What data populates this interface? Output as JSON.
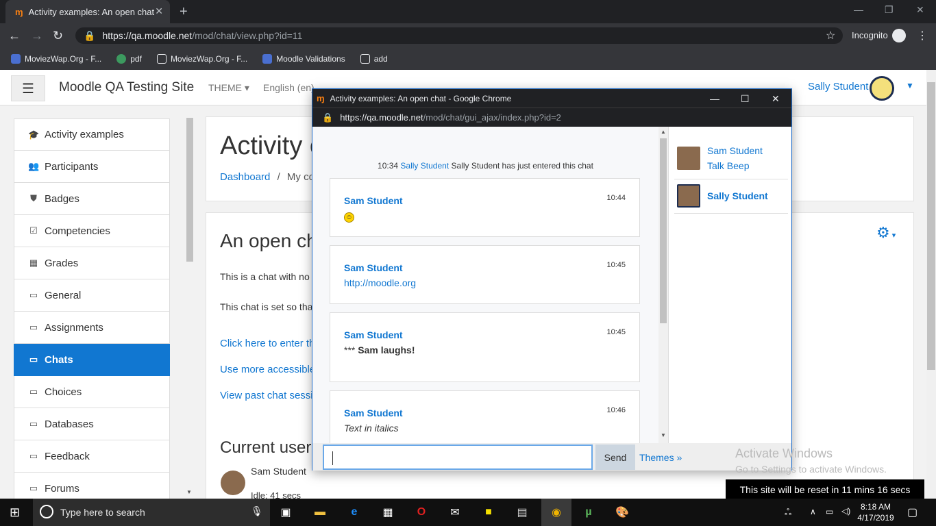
{
  "browser": {
    "tab_title": "Activity examples: An open chat",
    "url_host": "https://qa.moodle.net",
    "url_path": "/mod/chat/view.php?id=11",
    "incognito_label": "Incognito",
    "bookmarks": [
      "MoviezWap.Org - F...",
      "pdf",
      "MoviezWap.Org - F...",
      "Moodle Validations",
      "add"
    ]
  },
  "navbar": {
    "site_name": "Moodle QA Testing Site",
    "theme_menu": "THEME",
    "lang_menu": "English (en)",
    "user_name": "Sally Student"
  },
  "sidebar": {
    "items": [
      {
        "label": "Activity examples",
        "icon": "graduation-cap-icon"
      },
      {
        "label": "Participants",
        "icon": "users-icon"
      },
      {
        "label": "Badges",
        "icon": "shield-icon"
      },
      {
        "label": "Competencies",
        "icon": "checkbox-icon"
      },
      {
        "label": "Grades",
        "icon": "table-icon"
      },
      {
        "label": "General",
        "icon": "folder-icon"
      },
      {
        "label": "Assignments",
        "icon": "folder-icon"
      },
      {
        "label": "Chats",
        "icon": "folder-icon",
        "active": true
      },
      {
        "label": "Choices",
        "icon": "folder-icon"
      },
      {
        "label": "Databases",
        "icon": "folder-icon"
      },
      {
        "label": "Feedback",
        "icon": "folder-icon"
      },
      {
        "label": "Forums",
        "icon": "folder-icon"
      }
    ]
  },
  "main": {
    "heading": "Activity examples",
    "breadcrumb_dashboard": "Dashboard",
    "breadcrumb_sep": "/",
    "breadcrumb_next": "My courses",
    "section_title": "An open chat",
    "intro_1": "This is a chat with no",
    "intro_2": "This chat is set so that",
    "link_enter": "Click here to enter the chat",
    "link_accessible": "Use more accessible interface",
    "link_past": "View past chat sessions",
    "current_users_title": "Current users",
    "current_user_name": "Sam Student",
    "current_user_idle": "Idle: 41 secs"
  },
  "popup": {
    "window_title": "Activity examples: An open chat - Google Chrome",
    "url_host": "https://qa.moodle.net",
    "url_path": "/mod/chat/gui_ajax/index.php?id=2",
    "system_message": {
      "time": "10:34",
      "user": "Sally Student",
      "text": "Sally Student has just entered this chat"
    },
    "messages": [
      {
        "name": "Sam Student",
        "time": "10:44",
        "text": ""
      },
      {
        "name": "Sam Student",
        "time": "10:45",
        "text": "http://moodle.org"
      },
      {
        "name": "Sam Student",
        "time": "10:45",
        "prefix": "***",
        "text": "Sam laughs!"
      },
      {
        "name": "Sam Student",
        "time": "10:46",
        "text": "Text in italics"
      }
    ],
    "users": [
      {
        "name": "Sam Student",
        "action": "Talk",
        "beep": "Beep"
      },
      {
        "name": "Sally Student"
      }
    ],
    "input_value": "",
    "send_label": "Send",
    "themes_label": "Themes »"
  },
  "overlay": {
    "activate_title": "Activate Windows",
    "activate_sub": "Go to Settings to activate Windows.",
    "reset_notice": "This site will be reset in 11 mins 16 secs"
  },
  "taskbar": {
    "search_placeholder": "Type here to search",
    "time": "8:18 AM",
    "date": "4/17/2019"
  },
  "colors": {
    "accent": "#1177d1",
    "chrome_dark": "#202124"
  }
}
